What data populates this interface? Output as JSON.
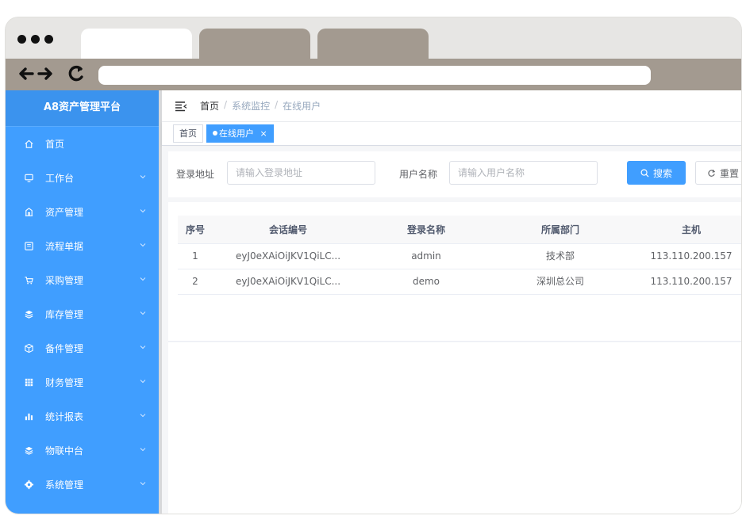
{
  "browser": {
    "tabs": [
      "",
      "",
      ""
    ],
    "url": ""
  },
  "sidebar": {
    "logo": "A8资产管理平台",
    "items": [
      {
        "label": "首页",
        "icon": "home-icon",
        "has_children": false
      },
      {
        "label": "工作台",
        "icon": "monitor-icon",
        "has_children": true
      },
      {
        "label": "资产管理",
        "icon": "building-icon",
        "has_children": true
      },
      {
        "label": "流程单据",
        "icon": "document-icon",
        "has_children": true
      },
      {
        "label": "采购管理",
        "icon": "cart-icon",
        "has_children": true
      },
      {
        "label": "库存管理",
        "icon": "layers-icon",
        "has_children": true
      },
      {
        "label": "备件管理",
        "icon": "box-icon",
        "has_children": true
      },
      {
        "label": "财务管理",
        "icon": "grid-icon",
        "has_children": true
      },
      {
        "label": "统计报表",
        "icon": "bar-chart-icon",
        "has_children": true
      },
      {
        "label": "物联中台",
        "icon": "stack-icon",
        "has_children": true
      },
      {
        "label": "系统管理",
        "icon": "gear-icon",
        "has_children": true
      }
    ]
  },
  "breadcrumb": [
    "首页",
    "系统监控",
    "在线用户"
  ],
  "tags": {
    "home": "首页",
    "active": "在线用户"
  },
  "search": {
    "login_address_label": "登录地址",
    "login_address_placeholder": "请输入登录地址",
    "username_label": "用户名称",
    "username_placeholder": "请输入用户名称",
    "search_button": "搜索",
    "reset_button": "重置"
  },
  "table": {
    "columns": [
      "序号",
      "会话编号",
      "登录名称",
      "所属部门",
      "主机"
    ],
    "rows": [
      [
        "1",
        "eyJ0eXAiOiJKV1QiLC...",
        "admin",
        "技术部",
        "113.110.200.157"
      ],
      [
        "2",
        "eyJ0eXAiOiJKV1QiLC...",
        "demo",
        "深圳总公司",
        "113.110.200.157"
      ]
    ]
  },
  "colors": {
    "sidebar": "#409eff",
    "primary": "#409eff",
    "browser_chrome": "#a39a90"
  }
}
